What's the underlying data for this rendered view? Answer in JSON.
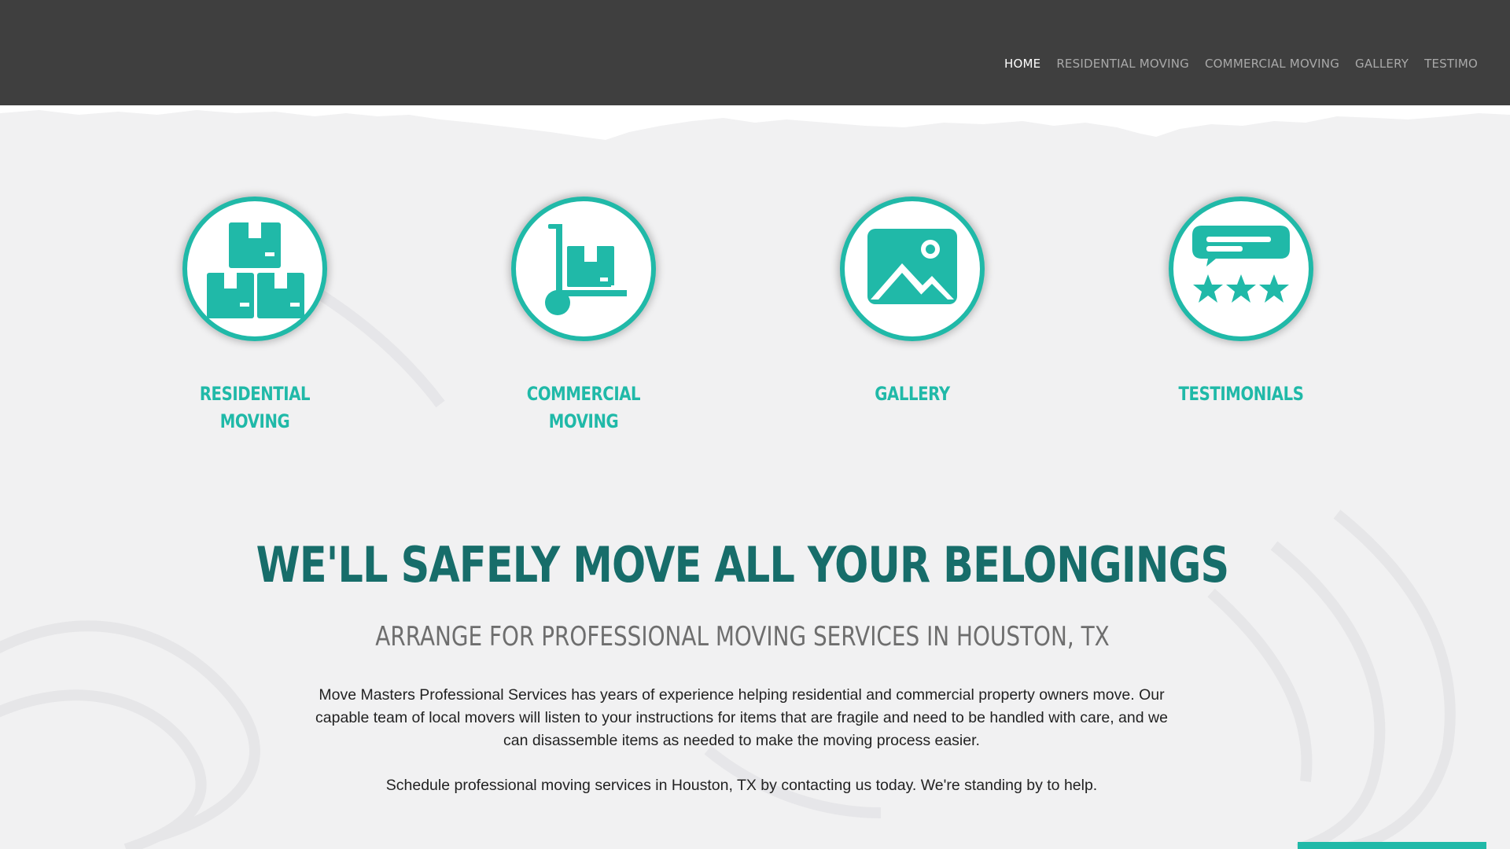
{
  "nav": {
    "items": [
      {
        "label": "HOME",
        "active": true
      },
      {
        "label": "RESIDENTIAL MOVING",
        "active": false
      },
      {
        "label": "COMMERCIAL MOVING",
        "active": false
      },
      {
        "label": "GALLERY",
        "active": false
      },
      {
        "label": "TESTIMO",
        "active": false
      }
    ]
  },
  "services": [
    {
      "label": "RESIDENTIAL\nMOVING",
      "icon": "boxes-icon"
    },
    {
      "label": "COMMERCIAL\nMOVING",
      "icon": "hand-truck-icon"
    },
    {
      "label": "GALLERY",
      "icon": "image-icon"
    },
    {
      "label": "TESTIMONIALS",
      "icon": "review-stars-icon"
    }
  ],
  "hero": {
    "title": "WE'LL SAFELY MOVE ALL YOUR BELONGINGS",
    "subtitle": "ARRANGE FOR PROFESSIONAL MOVING SERVICES IN HOUSTON, TX",
    "paragraph1": "Move Masters Professional Services has years of experience helping residential and commercial property owners move. Our capable team of local movers will listen to your instructions for items that are fragile and need to be handled with care, and we can disassemble items as needed to make the moving process easier.",
    "paragraph2": "Schedule professional moving services in Houston, TX by contacting us today. We're standing by to help."
  },
  "colors": {
    "header": "#3f3f3f",
    "teal": "#20b9a8",
    "dark_teal": "#176d6a",
    "background": "#f1f1f2"
  }
}
